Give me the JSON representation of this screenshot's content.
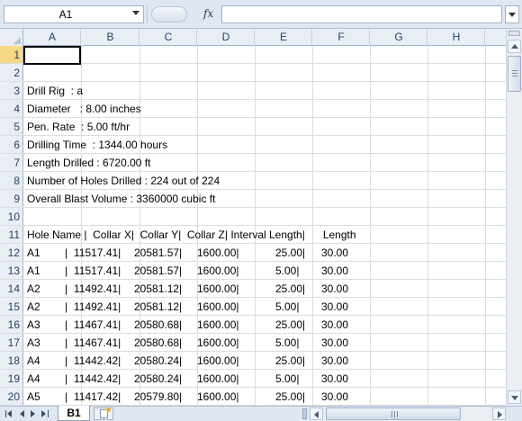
{
  "formula_bar": {
    "name_box": "A1",
    "fx_label": "fx",
    "formula": ""
  },
  "columns": [
    "A",
    "B",
    "C",
    "D",
    "E",
    "F",
    "G",
    "H"
  ],
  "info_rows": [
    {
      "row": "1",
      "text": ""
    },
    {
      "row": "2",
      "text": ""
    },
    {
      "row": "3",
      "text": "Drill Rig  : a"
    },
    {
      "row": "4",
      "text": "Diameter   : 8.00 inches"
    },
    {
      "row": "5",
      "text": "Pen. Rate  : 5.00 ft/hr"
    },
    {
      "row": "6",
      "text": "Drilling Time  : 1344.00 hours"
    },
    {
      "row": "7",
      "text": "Length Drilled : 6720.00 ft"
    },
    {
      "row": "8",
      "text": "Number of Holes Drilled : 224 out of 224"
    },
    {
      "row": "9",
      "text": "Overall Blast Volume : 3360000 cubic ft"
    },
    {
      "row": "10",
      "text": ""
    }
  ],
  "header_row": {
    "row": "11",
    "text": "Hole Name |  Collar X|  Collar Y|  Collar Z| Interval Length|      Length"
  },
  "data_rows": [
    {
      "row": "12",
      "hole": "A1",
      "x": "11517.41|",
      "y": "20581.57|",
      "z": "1600.00|",
      "interval": "25.00|",
      "length": "30.00"
    },
    {
      "row": "13",
      "hole": "A1",
      "x": "11517.41|",
      "y": "20581.57|",
      "z": "1600.00|",
      "interval": "5.00|",
      "length": "30.00"
    },
    {
      "row": "14",
      "hole": "A2",
      "x": "11492.41|",
      "y": "20581.12|",
      "z": "1600.00|",
      "interval": "25.00|",
      "length": "30.00"
    },
    {
      "row": "15",
      "hole": "A2",
      "x": "11492.41|",
      "y": "20581.12|",
      "z": "1600.00|",
      "interval": "5.00|",
      "length": "30.00"
    },
    {
      "row": "16",
      "hole": "A3",
      "x": "11467.41|",
      "y": "20580.68|",
      "z": "1600.00|",
      "interval": "25.00|",
      "length": "30.00"
    },
    {
      "row": "17",
      "hole": "A3",
      "x": "11467.41|",
      "y": "20580.68|",
      "z": "1600.00|",
      "interval": "5.00|",
      "length": "30.00"
    },
    {
      "row": "18",
      "hole": "A4",
      "x": "11442.42|",
      "y": "20580.24|",
      "z": "1600.00|",
      "interval": "25.00|",
      "length": "30.00"
    },
    {
      "row": "19",
      "hole": "A4",
      "x": "11442.42|",
      "y": "20580.24|",
      "z": "1600.00|",
      "interval": "5.00|",
      "length": "30.00"
    },
    {
      "row": "20",
      "hole": "A5",
      "x": "11417.42|",
      "y": "20579.80|",
      "z": "1600.00|",
      "interval": "25.00|",
      "length": "30.00"
    }
  ],
  "pipe": "|",
  "sheet_tab": "B1"
}
